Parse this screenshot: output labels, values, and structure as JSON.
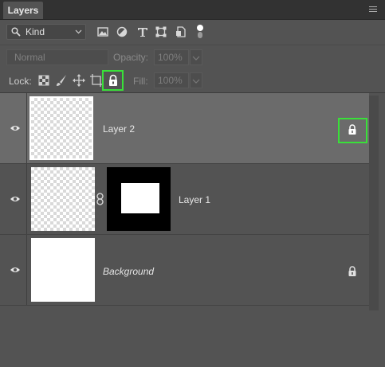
{
  "panel": {
    "tab_label": "Layers"
  },
  "filter": {
    "kind_label": "Kind",
    "icons": [
      "image-filter-icon",
      "adjustment-filter-icon",
      "type-filter-icon",
      "shape-filter-icon",
      "smart-object-filter-icon",
      "filter-toggle-icon"
    ]
  },
  "blend": {
    "mode": "Normal",
    "opacity_label": "Opacity:",
    "opacity_value": "100%"
  },
  "lock": {
    "label": "Lock:",
    "icons": [
      "lock-transparent-pixels-icon",
      "lock-image-pixels-icon",
      "lock-position-icon",
      "lock-artboard-icon",
      "lock-all-icon"
    ],
    "fill_label": "Fill:",
    "fill_value": "100%"
  },
  "layers": [
    {
      "name": "Layer 2",
      "visible": true,
      "selected": true,
      "locked": true
    },
    {
      "name": "Layer 1",
      "visible": true,
      "selected": false,
      "has_mask": true,
      "linked": true
    },
    {
      "name": "Background",
      "visible": true,
      "selected": false,
      "locked": true
    }
  ],
  "colors": {
    "highlight": "#39e039",
    "panel_bg": "#535353",
    "selected_row": "#6b6b6b"
  }
}
